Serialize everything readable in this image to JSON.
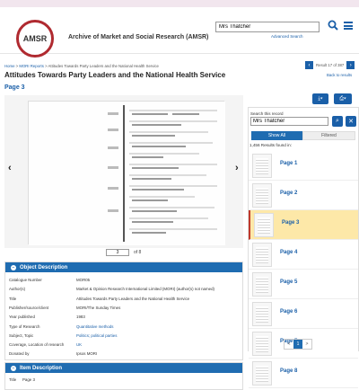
{
  "header": {
    "logo_text": "AMSR",
    "site_title": "Archive of Market and Social Research (AMSR)",
    "search_value": "Mrs Thatcher",
    "advanced_search": "Advanced Search"
  },
  "breadcrumb": {
    "home": "Home",
    "reports": "MORI Reports",
    "current": "Attitudes Towards Party Leaders and the National Health Service",
    "sep": ">"
  },
  "record": {
    "title": "Attitudes Towards Party Leaders and the National Health Service",
    "page_label": "Page 3",
    "result_text": "Result 17 of 387",
    "back_text": "Back to results"
  },
  "viewer": {
    "page_input": "3",
    "page_of": "of 8"
  },
  "object_description": {
    "heading": "Object Description",
    "rows": [
      {
        "label": "Catalogue Number",
        "value": "MOR05",
        "link": false
      },
      {
        "label": "Author(s)",
        "value": "Market & Opinion Research International Limited (MORI) (author(s) not named)",
        "link": false
      },
      {
        "label": "Title",
        "value": "Attitudes Towards Party Leaders and the National Health Service",
        "link": false
      },
      {
        "label": "Publisher/source/client",
        "value": "MORI/The Sunday Times",
        "link": false
      },
      {
        "label": "Year published",
        "value": "1983",
        "link": false
      },
      {
        "label": "Type of Research",
        "value": "Quantitative methods",
        "link": true
      },
      {
        "label": "Subject, Topic",
        "value": "Politics; political parties",
        "link": true
      },
      {
        "label": "Coverage, Location of research",
        "value": "UK",
        "link": true
      },
      {
        "label": "Donated by",
        "value": "Ipsos MORI",
        "link": false
      }
    ]
  },
  "item_description": {
    "heading": "Item Description",
    "title_label": "Title",
    "title_value": "Page 3"
  },
  "sidebar": {
    "search_label": "Search this record",
    "search_value": "Mrs Thatcher",
    "show_all": "Show All",
    "filtered": "Filtered",
    "found_text": "1,456 Results found in:",
    "pages": [
      "Page 1",
      "Page 2",
      "Page 3",
      "Page 4",
      "Page 5",
      "Page 6",
      "Page 7",
      "Page 8"
    ],
    "active_page": "Page 3",
    "pager": {
      "prev": "<",
      "current": "1",
      "next": ">"
    }
  },
  "colors": {
    "accent": "#1f6cb1",
    "logo_ring": "#b02a30",
    "active_row": "#fde8a8"
  }
}
